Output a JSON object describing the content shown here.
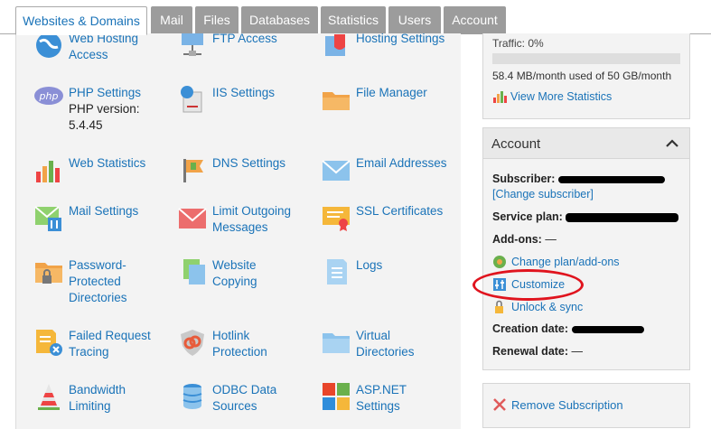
{
  "tabs": [
    {
      "label": "Websites & Domains",
      "active": true
    },
    {
      "label": "Mail"
    },
    {
      "label": "Files"
    },
    {
      "label": "Databases"
    },
    {
      "label": "Statistics"
    },
    {
      "label": "Users"
    },
    {
      "label": "Account"
    }
  ],
  "tools": {
    "web_hosting_access": {
      "label1": "Web Hosting",
      "label2": "Access",
      "icon": "globe-icon"
    },
    "ftp_access": {
      "label1": "FTP Access",
      "icon": "network-icon"
    },
    "hosting_settings": {
      "label1": "Hosting Settings",
      "icon": "hosting-settings-icon"
    },
    "php_settings": {
      "label1": "PHP Settings",
      "sub1": "PHP version:",
      "sub2": "5.4.45",
      "icon": "php-icon",
      "icon_text": "php"
    },
    "iis_settings": {
      "label1": "IIS Settings",
      "icon": "server-globe-icon"
    },
    "file_manager": {
      "label1": "File Manager",
      "icon": "folder-icon"
    },
    "web_statistics": {
      "label1": "Web Statistics",
      "icon": "bar-chart-icon"
    },
    "dns_settings": {
      "label1": "DNS Settings",
      "icon": "dns-flag-icon"
    },
    "email_addresses": {
      "label1": "Email Addresses",
      "icon": "envelope-icon"
    },
    "mail_settings": {
      "label1": "Mail Settings",
      "icon": "mail-settings-icon"
    },
    "limit_outgoing": {
      "label1": "Limit Outgoing",
      "label2": "Messages",
      "icon": "red-envelope-icon"
    },
    "ssl_certificates": {
      "label1": "SSL Certificates",
      "icon": "certificate-icon"
    },
    "password_dirs": {
      "label1": "Password-",
      "label2": "Protected",
      "label3": "Directories",
      "icon": "locked-folder-icon"
    },
    "website_copying": {
      "label1": "Website",
      "label2": "Copying",
      "icon": "copy-pages-icon"
    },
    "logs": {
      "label1": "Logs",
      "icon": "log-file-icon"
    },
    "failed_request": {
      "label1": "Failed Request",
      "label2": "Tracing",
      "icon": "failed-request-icon"
    },
    "hotlink": {
      "label1": "Hotlink",
      "label2": "Protection",
      "icon": "hotlink-shield-icon"
    },
    "virtual_dirs": {
      "label1": "Virtual",
      "label2": "Directories",
      "icon": "virtual-folder-icon"
    },
    "bandwidth": {
      "label1": "Bandwidth",
      "label2": "Limiting",
      "icon": "bandwidth-icon"
    },
    "odbc": {
      "label1": "ODBC Data",
      "label2": "Sources",
      "icon": "database-icon"
    },
    "aspnet": {
      "label1": "ASP.NET",
      "label2": "Settings",
      "icon": "aspnet-icon"
    }
  },
  "traffic": {
    "label": "Traffic: 0%",
    "percent": 0,
    "used_text": "58.4 MB/month used of 50 GB/month",
    "more_stats": "View More Statistics"
  },
  "account": {
    "title": "Account",
    "subscriber_label": "Subscriber:",
    "change_subscriber": "[Change subscriber]",
    "service_plan_label": "Service plan:",
    "addons_label": "Add-ons:",
    "addons_value": "—",
    "change_plan": "Change plan/add-ons",
    "customize": "Customize",
    "unlock_sync": "Unlock & sync",
    "creation_label": "Creation date:",
    "renewal_label": "Renewal date:",
    "renewal_value": "—"
  },
  "remove": {
    "label": "Remove Subscription"
  },
  "colors": {
    "accent": "#1a73b8",
    "highlight": "#e0141e",
    "tab_inactive": "#9c9c9c"
  }
}
